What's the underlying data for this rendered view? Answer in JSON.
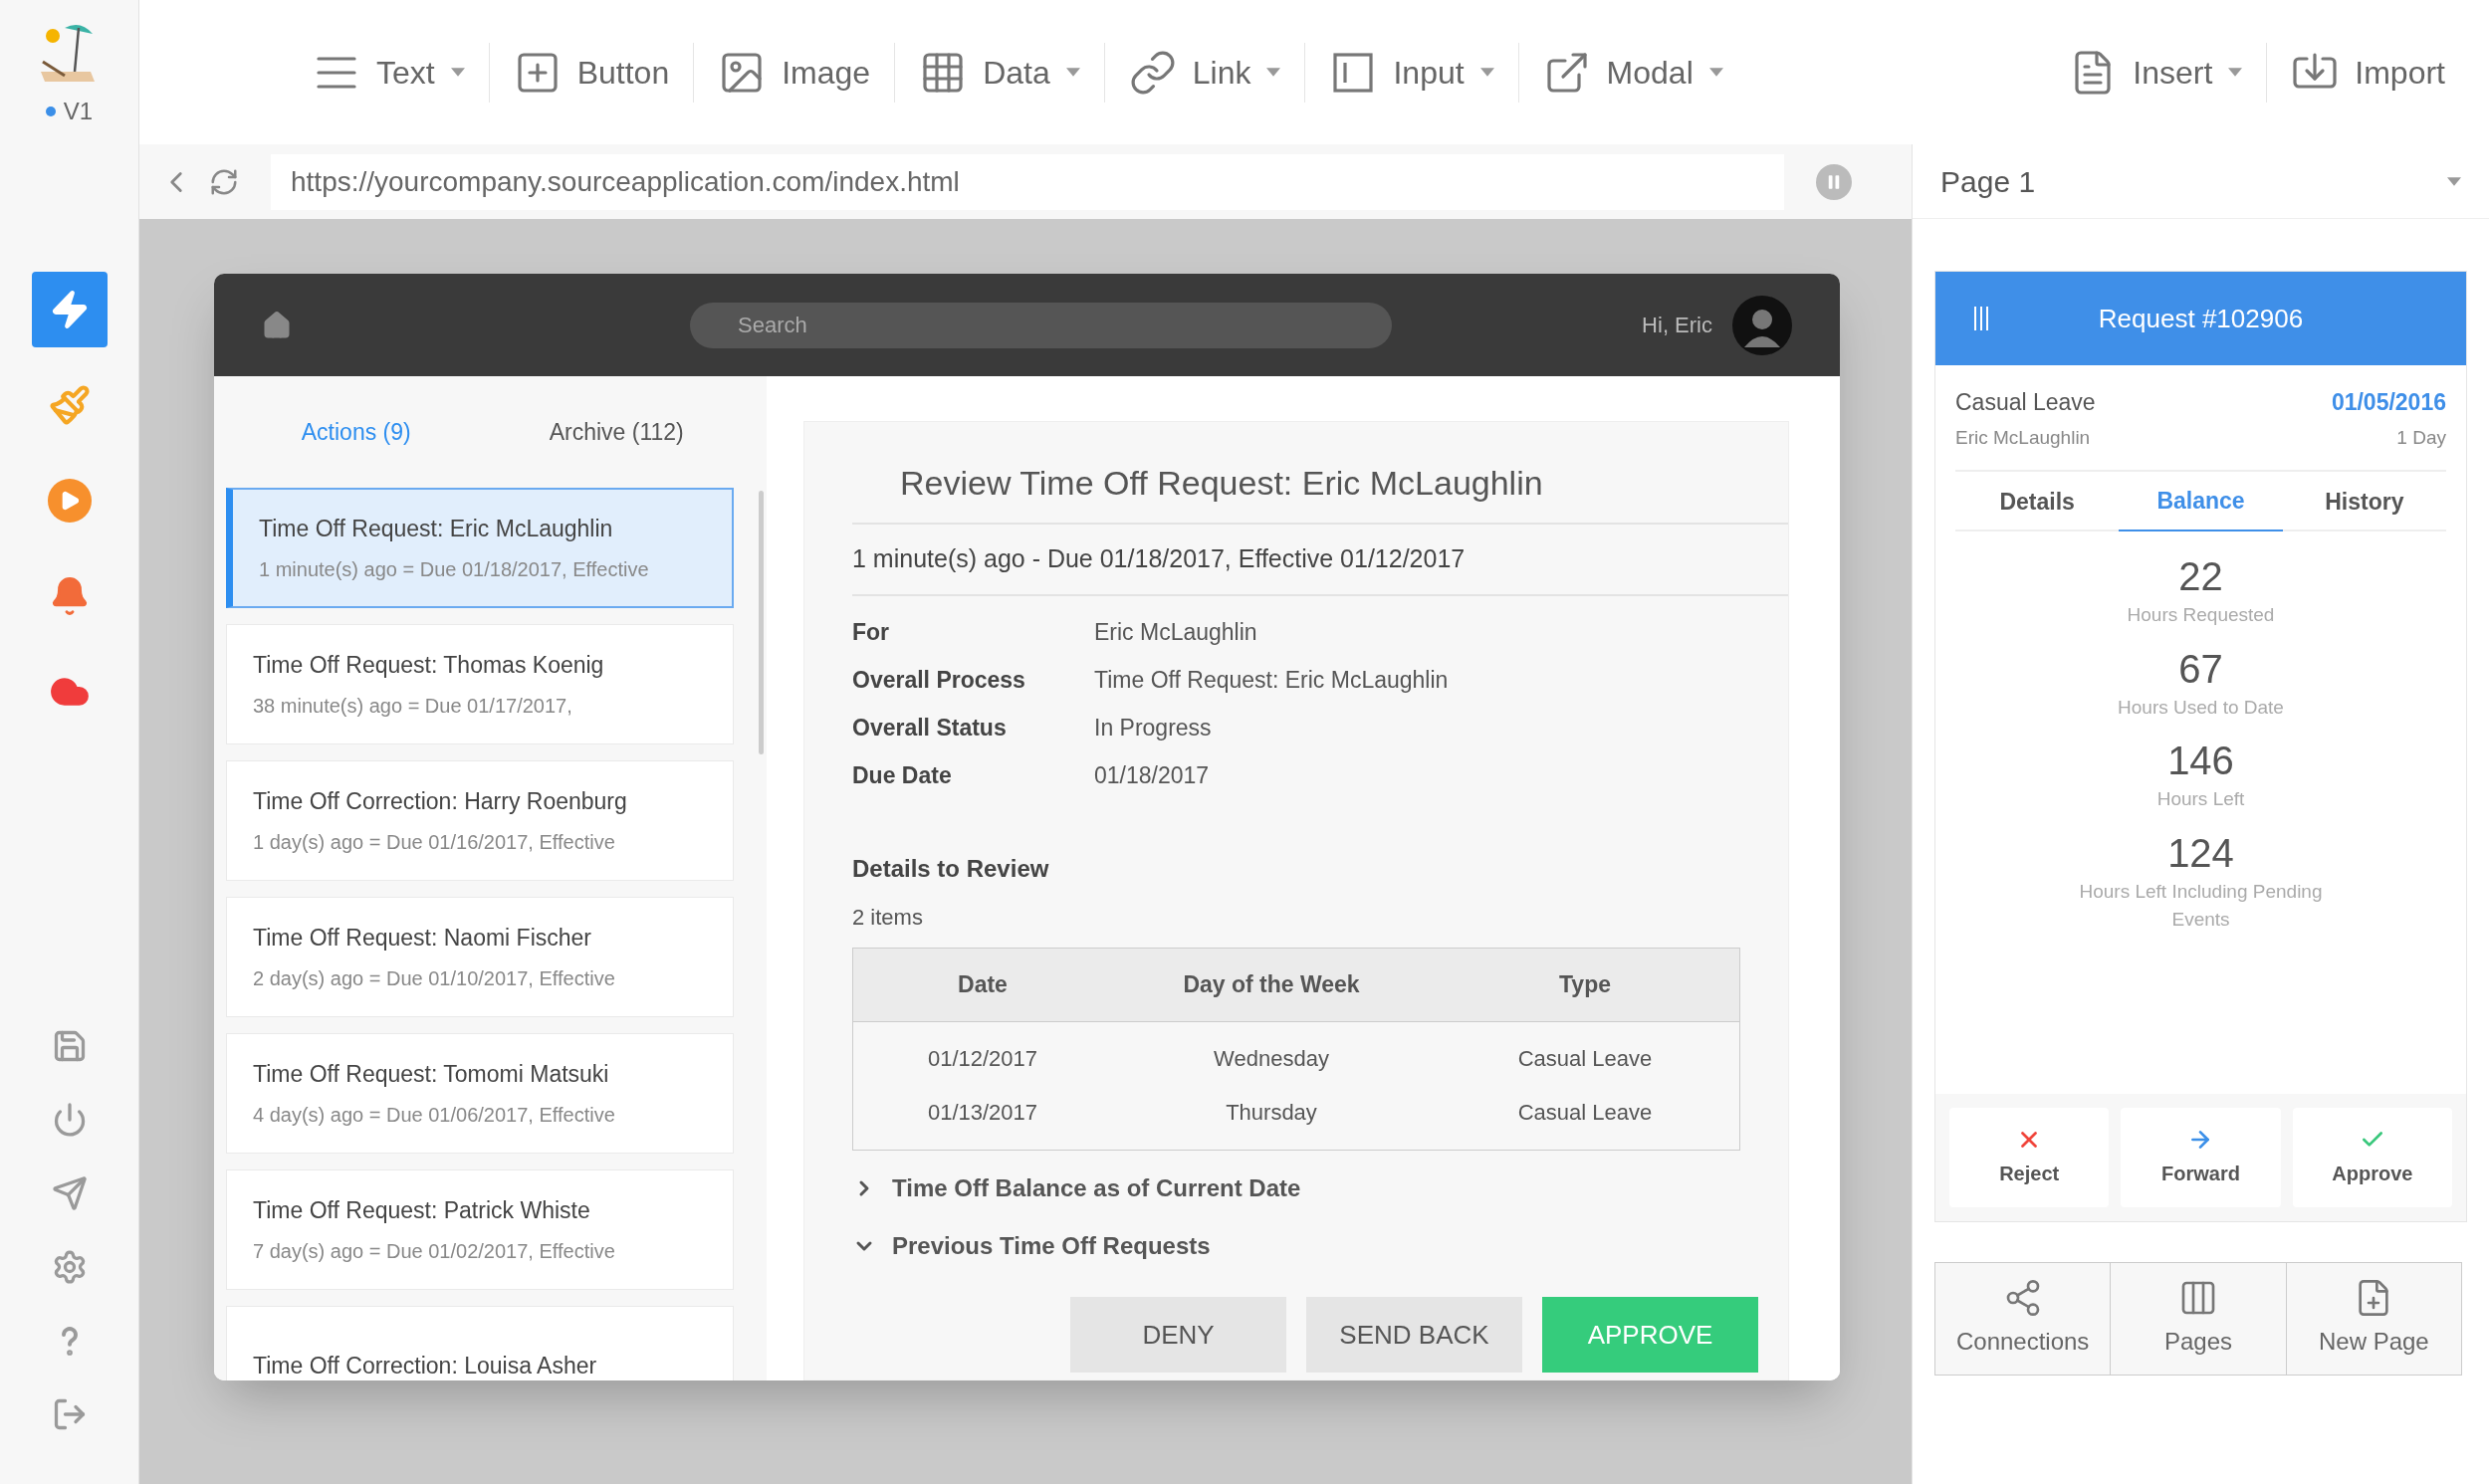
{
  "version": {
    "label": "V1"
  },
  "toolbar": {
    "items": [
      {
        "kind": "text",
        "label": "Text",
        "dropdown": true
      },
      {
        "kind": "button",
        "label": "Button",
        "dropdown": false
      },
      {
        "kind": "image",
        "label": "Image",
        "dropdown": false
      },
      {
        "kind": "data",
        "label": "Data",
        "dropdown": true
      },
      {
        "kind": "link",
        "label": "Link",
        "dropdown": true
      },
      {
        "kind": "input",
        "label": "Input",
        "dropdown": true
      },
      {
        "kind": "modal",
        "label": "Modal",
        "dropdown": true
      }
    ],
    "right_items": [
      {
        "kind": "insert",
        "label": "Insert",
        "dropdown": true
      },
      {
        "kind": "import",
        "label": "Import",
        "dropdown": false
      }
    ]
  },
  "sidebar": {
    "tools": [
      {
        "kind": "lightning",
        "selected": true
      },
      {
        "kind": "brush",
        "selected": false
      },
      {
        "kind": "play",
        "selected": false
      },
      {
        "kind": "bell",
        "selected": false
      },
      {
        "kind": "cloud",
        "selected": false
      }
    ],
    "bottom": [
      {
        "kind": "save"
      },
      {
        "kind": "power"
      },
      {
        "kind": "send"
      },
      {
        "kind": "settings"
      },
      {
        "kind": "help"
      },
      {
        "kind": "logout"
      }
    ]
  },
  "browser": {
    "url": "https://yourcompany.sourceapplication.com/index.html",
    "page_select": "Page 1"
  },
  "app": {
    "search": {
      "placeholder": "Search"
    },
    "greeting": "Hi, Eric",
    "tabs": [
      {
        "label": "Actions (9)",
        "selected": true
      },
      {
        "label": "Archive (112)",
        "selected": false
      }
    ],
    "items": [
      {
        "title": "Time Off Request: Eric McLaughlin",
        "subtitle": "1 minute(s) ago = Due 01/18/2017, Effective",
        "selected": true
      },
      {
        "title": "Time Off Request: Thomas Koenig",
        "subtitle": "38 minute(s) ago = Due 01/17/2017,",
        "selected": false
      },
      {
        "title": "Time Off Correction: Harry Roenburg",
        "subtitle": "1 day(s) ago = Due 01/16/2017, Effective",
        "selected": false
      },
      {
        "title": "Time Off Request: Naomi Fischer",
        "subtitle": "2 day(s) ago = Due 01/10/2017, Effective",
        "selected": false
      },
      {
        "title": "Time Off Request: Tomomi Matsuki",
        "subtitle": "4 day(s) ago = Due 01/06/2017, Effective",
        "selected": false
      },
      {
        "title": "Time Off Request: Patrick Whiste",
        "subtitle": "7 day(s) ago = Due 01/02/2017, Effective",
        "selected": false
      },
      {
        "title": "Time Off Correction: Louisa Asher",
        "selected": false
      }
    ],
    "detail": {
      "title": "Review Time Off Request: Eric McLaughlin",
      "subtitle": "1 minute(s) ago - Due 01/18/2017, Effective 01/12/2017",
      "fields": [
        {
          "label": "For",
          "value": "Eric McLaughlin"
        },
        {
          "label": "Overall Process",
          "value": "Time Off Request: Eric McLaughlin"
        },
        {
          "label": "Overall Status",
          "value": "In Progress"
        },
        {
          "label": "Due Date",
          "value": "01/18/2017"
        }
      ],
      "section": "Details to Review",
      "count": "2 items",
      "table": {
        "columns": [
          "Date",
          "Day of the Week",
          "Type"
        ],
        "rows": [
          [
            "01/12/2017",
            "Wednesday",
            "Casual Leave"
          ],
          [
            "01/13/2017",
            "Thursday",
            "Casual Leave"
          ]
        ]
      },
      "collapsibles": [
        {
          "label": "Time Off Balance as of Current Date",
          "expanded": false
        },
        {
          "label": "Previous Time Off Requests",
          "expanded": true
        }
      ],
      "buttons": [
        {
          "label": "DENY",
          "kind": "secondary"
        },
        {
          "label": "SEND BACK",
          "kind": "secondary"
        },
        {
          "label": "APPROVE",
          "kind": "primary"
        }
      ]
    }
  },
  "request": {
    "title": "Request #102906",
    "type": "Casual Leave",
    "name": "Eric McLaughlin",
    "date": "01/05/2016",
    "duration": "1 Day",
    "tabs": [
      {
        "label": "Details",
        "selected": false
      },
      {
        "label": "Balance",
        "selected": true
      },
      {
        "label": "History",
        "selected": false
      }
    ],
    "stats": [
      {
        "value": "22",
        "label": "Hours Requested"
      },
      {
        "value": "67",
        "label": "Hours Used to Date"
      },
      {
        "value": "146",
        "label": "Hours Left"
      },
      {
        "value": "124",
        "label": "Hours Left Including Pending Events"
      }
    ],
    "actions": [
      {
        "kind": "reject",
        "label": "Reject"
      },
      {
        "kind": "forward",
        "label": "Forward"
      },
      {
        "kind": "approve",
        "label": "Approve"
      }
    ]
  },
  "bottom_buttons": [
    {
      "kind": "connections",
      "label": "Connections"
    },
    {
      "kind": "pages",
      "label": "Pages"
    },
    {
      "kind": "new_page",
      "label": "New Page"
    }
  ]
}
